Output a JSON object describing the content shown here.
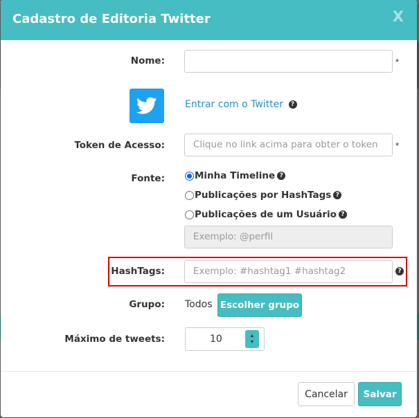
{
  "modal": {
    "title": "Cadastro de Editoria Twitter",
    "close": "X"
  },
  "form": {
    "nome": {
      "label": "Nome:",
      "value": "",
      "required": "*"
    },
    "twitter": {
      "logo": "twitter-bird-icon",
      "link": "Entrar com o Twitter",
      "help": "?"
    },
    "token": {
      "label": "Token de Acesso:",
      "placeholder": "Clique no link acima para obter o token",
      "required": "*"
    },
    "fonte": {
      "label": "Fonte:",
      "options": [
        {
          "label": "Minha Timeline",
          "checked": true,
          "help": "?"
        },
        {
          "label": "Publicações por HashTags",
          "checked": false,
          "help": "?"
        },
        {
          "label": "Publicações de um Usuário",
          "checked": false,
          "help": "?"
        }
      ],
      "perfil_placeholder": "Exemplo: @perfil"
    },
    "hashtags": {
      "label": "HashTags:",
      "placeholder": "Exemplo: #hashtag1 #hashtag2",
      "help": "?"
    },
    "grupo": {
      "label": "Grupo:",
      "value": "Todos",
      "button": "Escolher grupo"
    },
    "maximo": {
      "label": "Máximo de tweets:",
      "value": "10"
    }
  },
  "footer": {
    "cancel": "Cancelar",
    "save": "Salvar"
  },
  "colors": {
    "accent": "#46bdc2",
    "twitter": "#1da1f2",
    "highlight": "#e00000",
    "link": "#2c8ec6"
  }
}
